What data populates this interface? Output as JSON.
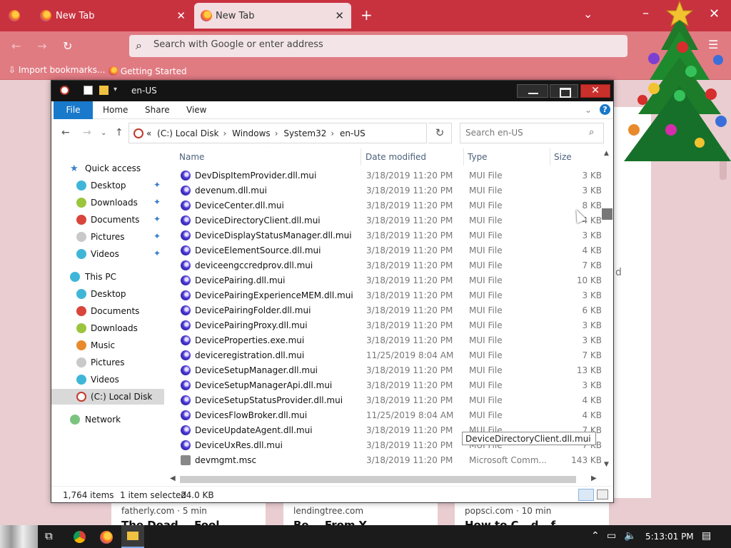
{
  "browser": {
    "tabs": [
      {
        "title": "New Tab",
        "active": false
      },
      {
        "title": "New Tab",
        "active": true
      }
    ],
    "address_placeholder": "Search with Google or enter address",
    "bookmarks": [
      "Import bookmarks...",
      "Getting Started"
    ],
    "accent": "#c8323f"
  },
  "background_page": {
    "partial_text": "d",
    "stories": [
      {
        "source": "fatherly.com · 5 min",
        "title": "The Dead... Fool..."
      },
      {
        "source": "lendingtree.com",
        "title": "Be... From Y..."
      },
      {
        "source": "popsci.com · 10 min",
        "title": "How to C...d...f"
      }
    ]
  },
  "explorer": {
    "title": "en-US",
    "ribbon": {
      "file": "File",
      "tabs": [
        "Home",
        "Share",
        "View"
      ],
      "help": "?"
    },
    "address": {
      "prefix": "«",
      "crumbs": [
        "(C:) Local Disk",
        "Windows",
        "System32",
        "en-US"
      ]
    },
    "search_placeholder": "Search en-US",
    "nav": {
      "quick_access": "Quick access",
      "quick_items": [
        "Desktop",
        "Downloads",
        "Documents",
        "Pictures",
        "Videos"
      ],
      "this_pc": "This PC",
      "pc_items": [
        "Desktop",
        "Documents",
        "Downloads",
        "Music",
        "Pictures",
        "Videos",
        "(C:) Local Disk"
      ],
      "network": "Network"
    },
    "columns": {
      "name": "Name",
      "date": "Date modified",
      "type": "Type",
      "size": "Size"
    },
    "files": [
      {
        "name": "DevDispItemProvider.dll.mui",
        "date": "3/18/2019 11:20 PM",
        "type": "MUI File",
        "size": "3 KB"
      },
      {
        "name": "devenum.dll.mui",
        "date": "3/18/2019 11:20 PM",
        "type": "MUI File",
        "size": "3 KB"
      },
      {
        "name": "DeviceCenter.dll.mui",
        "date": "3/18/2019 11:20 PM",
        "type": "MUI File",
        "size": "8 KB"
      },
      {
        "name": "DeviceDirectoryClient.dll.mui",
        "date": "3/18/2019 11:20 PM",
        "type": "MUI File",
        "size": "4 KB"
      },
      {
        "name": "DeviceDisplayStatusManager.dll.mui",
        "date": "3/18/2019 11:20 PM",
        "type": "MUI File",
        "size": "3 KB"
      },
      {
        "name": "DeviceElementSource.dll.mui",
        "date": "3/18/2019 11:20 PM",
        "type": "MUI File",
        "size": "4 KB"
      },
      {
        "name": "deviceengccredprov.dll.mui",
        "date": "3/18/2019 11:20 PM",
        "type": "MUI File",
        "size": "7 KB"
      },
      {
        "name": "DevicePairing.dll.mui",
        "date": "3/18/2019 11:20 PM",
        "type": "MUI File",
        "size": "10 KB"
      },
      {
        "name": "DevicePairingExperienceMEM.dll.mui",
        "date": "3/18/2019 11:20 PM",
        "type": "MUI File",
        "size": "3 KB"
      },
      {
        "name": "DevicePairingFolder.dll.mui",
        "date": "3/18/2019 11:20 PM",
        "type": "MUI File",
        "size": "6 KB"
      },
      {
        "name": "DevicePairingProxy.dll.mui",
        "date": "3/18/2019 11:20 PM",
        "type": "MUI File",
        "size": "3 KB"
      },
      {
        "name": "DeviceProperties.exe.mui",
        "date": "3/18/2019 11:20 PM",
        "type": "MUI File",
        "size": "3 KB"
      },
      {
        "name": "deviceregistration.dll.mui",
        "date": "11/25/2019 8:04 AM",
        "type": "MUI File",
        "size": "7 KB"
      },
      {
        "name": "DeviceSetupManager.dll.mui",
        "date": "3/18/2019 11:20 PM",
        "type": "MUI File",
        "size": "13 KB"
      },
      {
        "name": "DeviceSetupManagerApi.dll.mui",
        "date": "3/18/2019 11:20 PM",
        "type": "MUI File",
        "size": "3 KB"
      },
      {
        "name": "DeviceSetupStatusProvider.dll.mui",
        "date": "3/18/2019 11:20 PM",
        "type": "MUI File",
        "size": "4 KB"
      },
      {
        "name": "DevicesFlowBroker.dll.mui",
        "date": "11/25/2019 8:04 AM",
        "type": "MUI File",
        "size": "4 KB"
      },
      {
        "name": "DeviceUpdateAgent.dll.mui",
        "date": "3/18/2019 11:20 PM",
        "type": "MUI File",
        "size": "7 KB"
      },
      {
        "name": "DeviceUxRes.dll.mui",
        "date": "3/18/2019 11:20 PM",
        "type": "MUI File",
        "size": "7 KB"
      },
      {
        "name": "devmgmt.msc",
        "date": "3/18/2019 11:20 PM",
        "type": "Microsoft Comm...",
        "size": "143 KB"
      }
    ],
    "status": {
      "count": "1,764 items",
      "selection": "1 item selected",
      "selection_size": "24.0 KB"
    },
    "tooltip": "DeviceDirectoryClient.dll.mui"
  },
  "taskbar": {
    "time": "5:13:01 PM"
  }
}
